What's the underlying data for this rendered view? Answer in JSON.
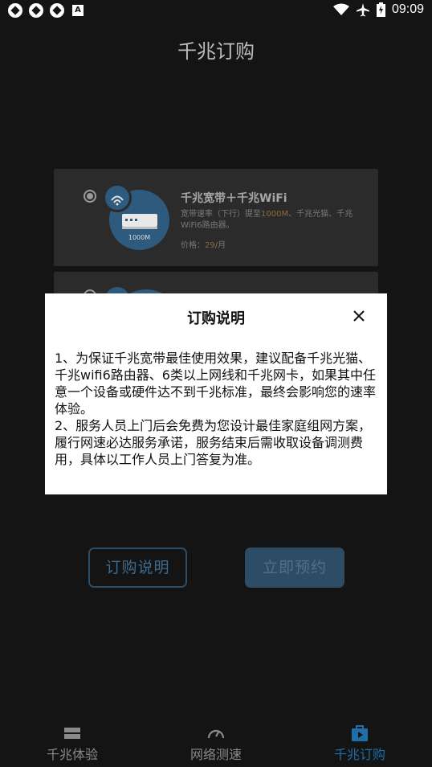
{
  "status_bar": {
    "time": "09:09",
    "notification_icons": [
      "sync-icon",
      "sync-icon",
      "sync-icon",
      "a-badge-icon"
    ],
    "right_icons": [
      "wifi-icon",
      "airplane-icon",
      "battery-charging-icon"
    ]
  },
  "header": {
    "title": "千兆订购"
  },
  "products": [
    {
      "title": "千兆宽带＋千兆WiFi",
      "desc_prefix": "宽带速率（下行）提至",
      "desc_speed": "1000M",
      "desc_suffix": "、千兆光猫、千兆WiFi6路由器。",
      "price_label": "价格：",
      "price_value": "29",
      "price_unit": "/月",
      "router_label": "1000M",
      "selected": true
    },
    {
      "selected": false
    }
  ],
  "buttons": {
    "info_label": "订购说明",
    "reserve_label": "立即预约"
  },
  "dialog": {
    "title": "订购说明",
    "close_icon": "close-icon",
    "body": "1、为保证千兆宽带最佳使用效果，建议配备千兆光猫、千兆wifi6路由器、6类以上网线和千兆网卡，如果其中任意一个设备或硬件达不到千兆标准，最终会影响您的速率体验。\n2、服务人员上门后会免费为您设计最佳家庭组网方案，履行网速必达服务承诺，服务结束后需收取设备调测费用，具体以工作人员上门答复为准。"
  },
  "bottom_nav": {
    "items": [
      {
        "label": "千兆体验",
        "icon": "layers-icon",
        "active": false
      },
      {
        "label": "网络测速",
        "icon": "speedometer-icon",
        "active": false
      },
      {
        "label": "千兆订购",
        "icon": "shopping-bag-icon",
        "active": true
      }
    ]
  },
  "colors": {
    "accent": "#1f6ea8",
    "background": "#141414",
    "card": "#2b2b2b",
    "price_highlight": "#8a6d3a"
  }
}
